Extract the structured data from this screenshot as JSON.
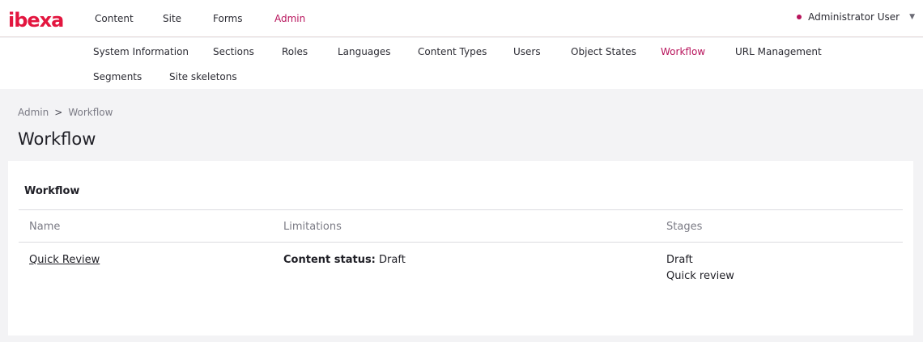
{
  "brand": {
    "logo_text": "ibexa",
    "accent": "#b8145c"
  },
  "main_nav": [
    {
      "label": "Content"
    },
    {
      "label": "Site"
    },
    {
      "label": "Forms"
    },
    {
      "label": "Admin"
    }
  ],
  "user": {
    "name": "Administrator User"
  },
  "sub_nav": [
    {
      "label": "System Information"
    },
    {
      "label": "Sections"
    },
    {
      "label": "Roles"
    },
    {
      "label": "Languages"
    },
    {
      "label": "Content Types"
    },
    {
      "label": "Users"
    },
    {
      "label": "Object States"
    },
    {
      "label": "Workflow"
    },
    {
      "label": "URL Management"
    },
    {
      "label": "Segments"
    },
    {
      "label": "Site skeletons"
    }
  ],
  "breadcrumb": {
    "parent": "Admin",
    "separator": ">",
    "current": "Workflow"
  },
  "page": {
    "title": "Workflow"
  },
  "card": {
    "title": "Workflow",
    "columns": {
      "name": "Name",
      "limitations": "Limitations",
      "stages": "Stages"
    },
    "rows": [
      {
        "name": "Quick Review",
        "limitation_label": "Content status:",
        "limitation_value": "Draft",
        "stages": [
          "Draft",
          "Quick review"
        ]
      }
    ]
  }
}
